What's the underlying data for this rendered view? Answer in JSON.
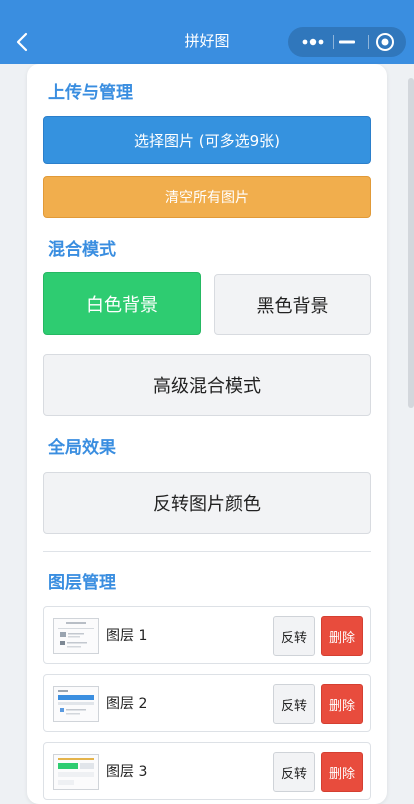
{
  "header": {
    "title": "拼好图"
  },
  "sections": {
    "upload": {
      "title": "上传与管理",
      "select_label": "选择图片 (可多选9张)",
      "clear_label": "清空所有图片"
    },
    "blend": {
      "title": "混合模式",
      "white_bg": "白色背景",
      "black_bg": "黑色背景",
      "advanced": "高级混合模式",
      "selected": "白色背景"
    },
    "global": {
      "title": "全局效果",
      "invert": "反转图片颜色"
    },
    "layers": {
      "title": "图层管理",
      "items": [
        {
          "name": "图层 1",
          "flip": "反转",
          "delete": "删除"
        },
        {
          "name": "图层 2",
          "flip": "反转",
          "delete": "删除"
        },
        {
          "name": "图层 3",
          "flip": "反转",
          "delete": "删除"
        }
      ]
    }
  },
  "colors": {
    "primary": "#3a8ee0",
    "orange": "#f1ae4d",
    "green": "#2ecc71",
    "red": "#e84c3d"
  },
  "icons": {
    "back": "chevron-left-icon",
    "more": "more-dots-icon",
    "minimize": "minimize-icon",
    "close": "target-close-icon"
  }
}
